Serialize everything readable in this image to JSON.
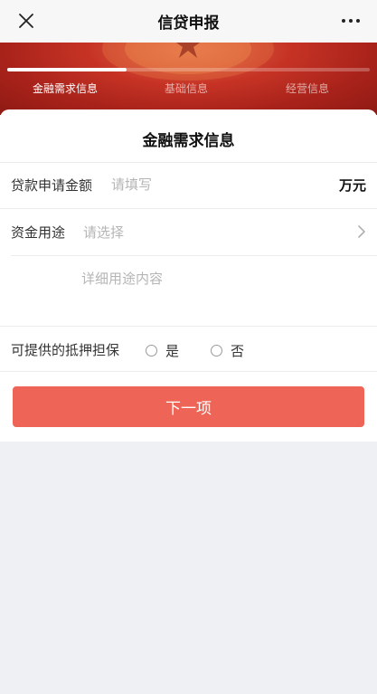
{
  "navbar": {
    "title": "信贷申报",
    "close_icon": "close-icon",
    "more_icon": "more-icon"
  },
  "progress": {
    "steps": [
      "金融需求信息",
      "基础信息",
      "经营信息"
    ],
    "current_step": 1,
    "fraction_complete": 0.33
  },
  "form": {
    "title": "金融需求信息",
    "amount": {
      "label": "贷款申请金额",
      "placeholder": "请填写",
      "unit": "万元"
    },
    "purpose": {
      "label": "资金用途",
      "placeholder": "请选择",
      "detail_placeholder": "详细用途内容"
    },
    "collateral": {
      "label": "可提供的抵押担保",
      "options": [
        "是",
        "否"
      ]
    },
    "next_button": "下一项"
  },
  "colors": {
    "banner_red": "#c63325",
    "button_red": "#ee6456",
    "page_bg": "#eef0f3"
  }
}
